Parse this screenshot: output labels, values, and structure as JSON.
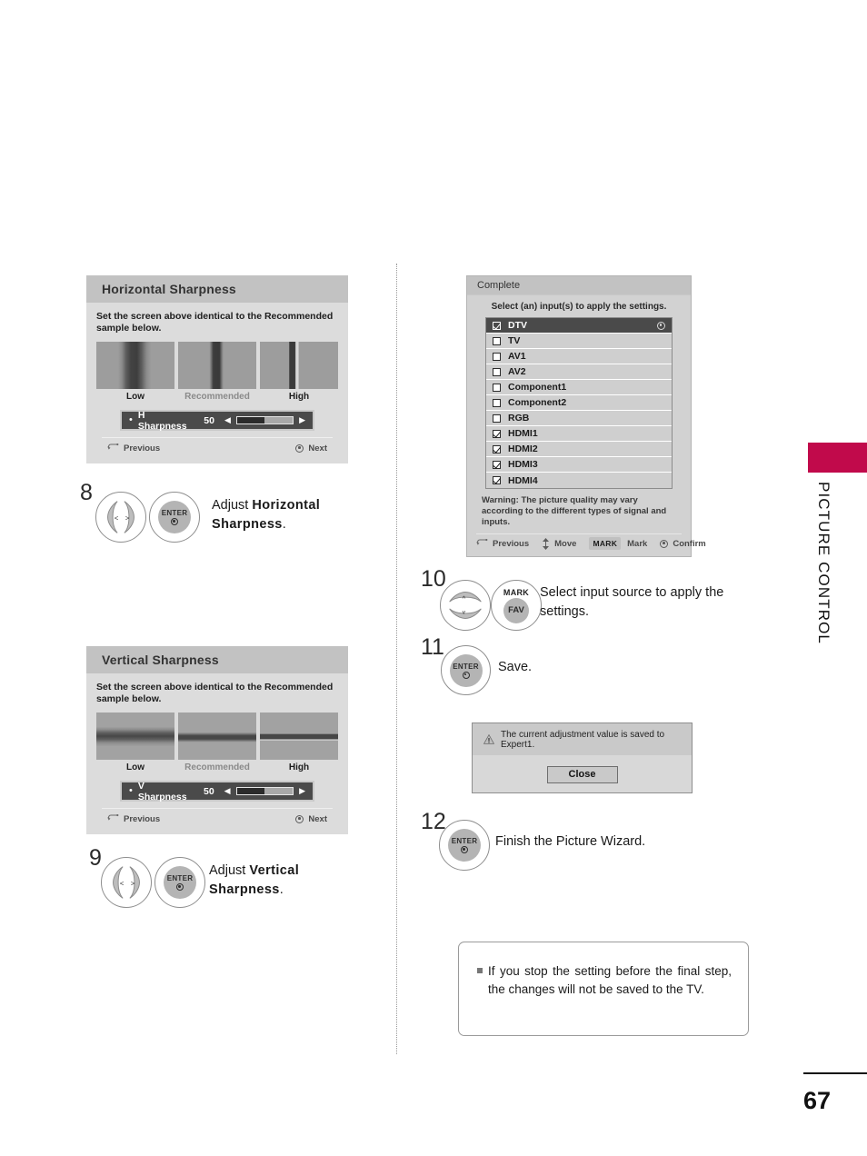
{
  "page": {
    "number": "67",
    "side_tab_label": "PICTURE CONTROL",
    "accent_color": "#c10a4b"
  },
  "horizontal_panel": {
    "title": "Horizontal Sharpness",
    "instruction": "Set the screen above identical to the Recommended sample  below.",
    "sample_labels": [
      "Low",
      "Recommended",
      "High"
    ],
    "slider": {
      "bullet": "•",
      "name": "H Sharpness",
      "value": "50",
      "left_arrow": "◀",
      "right_arrow": "▶"
    },
    "footer": {
      "previous": "Previous",
      "next": "Next"
    }
  },
  "vertical_panel": {
    "title": "Vertical Sharpness",
    "instruction": "Set the screen above identical to the Recommended sample  below.",
    "sample_labels": [
      "Low",
      "Recommended",
      "High"
    ],
    "slider": {
      "bullet": "•",
      "name": "V Sharpness",
      "value": "50",
      "left_arrow": "◀",
      "right_arrow": "▶"
    },
    "footer": {
      "previous": "Previous",
      "next": "Next"
    }
  },
  "complete_dialog": {
    "title": "Complete",
    "subtitle": "Select (an) input(s) to apply the settings.",
    "inputs": [
      {
        "label": "DTV",
        "checked": true,
        "selected": true
      },
      {
        "label": "TV",
        "checked": false,
        "selected": false
      },
      {
        "label": "AV1",
        "checked": false,
        "selected": false
      },
      {
        "label": "AV2",
        "checked": false,
        "selected": false
      },
      {
        "label": "Component1",
        "checked": false,
        "selected": false
      },
      {
        "label": "Component2",
        "checked": false,
        "selected": false
      },
      {
        "label": "RGB",
        "checked": false,
        "selected": false
      },
      {
        "label": "HDMI1",
        "checked": true,
        "selected": false
      },
      {
        "label": "HDMI2",
        "checked": true,
        "selected": false
      },
      {
        "label": "HDMI3",
        "checked": true,
        "selected": false
      },
      {
        "label": "HDMI4",
        "checked": true,
        "selected": false
      }
    ],
    "warning": "Warning: The picture quality  may vary according to the different types of signal and inputs.",
    "footer": {
      "previous": "Previous",
      "move": "Move",
      "mark_key": "MARK",
      "mark": "Mark",
      "confirm": "Confirm"
    }
  },
  "save_dialog": {
    "message": "The current adjustment value is saved to Expert1.",
    "close_label": "Close"
  },
  "note": {
    "bullet": "▪",
    "text": "If you stop the setting before the final step, the changes will not be saved to the TV."
  },
  "steps": {
    "s8": {
      "number": "8",
      "text_plain": "Adjust ",
      "text_bold": "Horizontal Sharpness",
      "text_tail": ".",
      "enter_label": "ENTER"
    },
    "s9": {
      "number": "9",
      "text_plain": "Adjust ",
      "text_bold": "Vertical Sharpness",
      "text_tail": ".",
      "enter_label": "ENTER"
    },
    "s10": {
      "number": "10",
      "text": "Select input source to apply the settings.",
      "mark_label": "MARK",
      "fav_label": "FAV"
    },
    "s11": {
      "number": "11",
      "text": "Save.",
      "enter_label": "ENTER"
    },
    "s12": {
      "number": "12",
      "text": "Finish the Picture Wizard.",
      "enter_label": "ENTER"
    }
  }
}
